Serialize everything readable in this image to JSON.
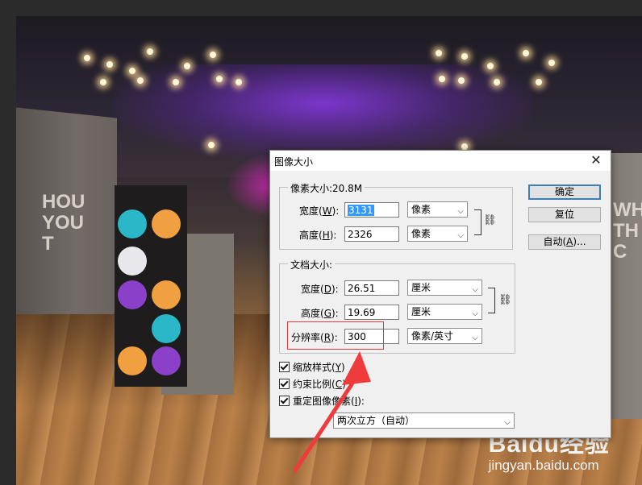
{
  "dialog": {
    "title": "图像大小",
    "close_glyph": "✕",
    "pixel_dimensions": {
      "title": "像素大小:20.8M",
      "width_label": "宽度(",
      "width_key": "W",
      "width_value": "3131",
      "width_unit": "像素",
      "height_label": "高度(",
      "height_key": "H",
      "height_value": "2326",
      "height_unit": "像素"
    },
    "document_size": {
      "title": "文档大小:",
      "width_label": "宽度(",
      "width_key": "D",
      "width_value": "26.51",
      "width_unit": "厘米",
      "height_label": "高度(",
      "height_key": "G",
      "height_value": "19.69",
      "height_unit": "厘米",
      "resolution_label": "分辨率(",
      "resolution_key": "R",
      "resolution_value": "300",
      "resolution_unit": "像素/英寸"
    },
    "label_close": "):",
    "buttons": {
      "ok": "确定",
      "reset": "复位",
      "auto_prefix": "自动(",
      "auto_key": "A",
      "auto_suffix": ")..."
    },
    "checkboxes": {
      "scale_styles_prefix": "缩放样式(",
      "scale_styles_key": "Y",
      "scale_styles_suffix": ")",
      "constrain_prefix": "约束比例(",
      "constrain_key": "C",
      "constrain_suffix": ")",
      "resample_prefix": "重定图像像素(",
      "resample_key": "I",
      "resample_suffix": "):"
    },
    "resample_method": "两次立方（自动）"
  },
  "background": {
    "wall_text_left": "HOU\nYOU\nT",
    "wall_text_right": "WHE\nTH\nC"
  },
  "watermark": {
    "brand": "Baidu经验",
    "url": "jingyan.baidu.com"
  },
  "colors": {
    "annotation_red": "#e23b3b",
    "selection_blue": "#3399ff",
    "default_button_border": "#3c7fb1"
  }
}
